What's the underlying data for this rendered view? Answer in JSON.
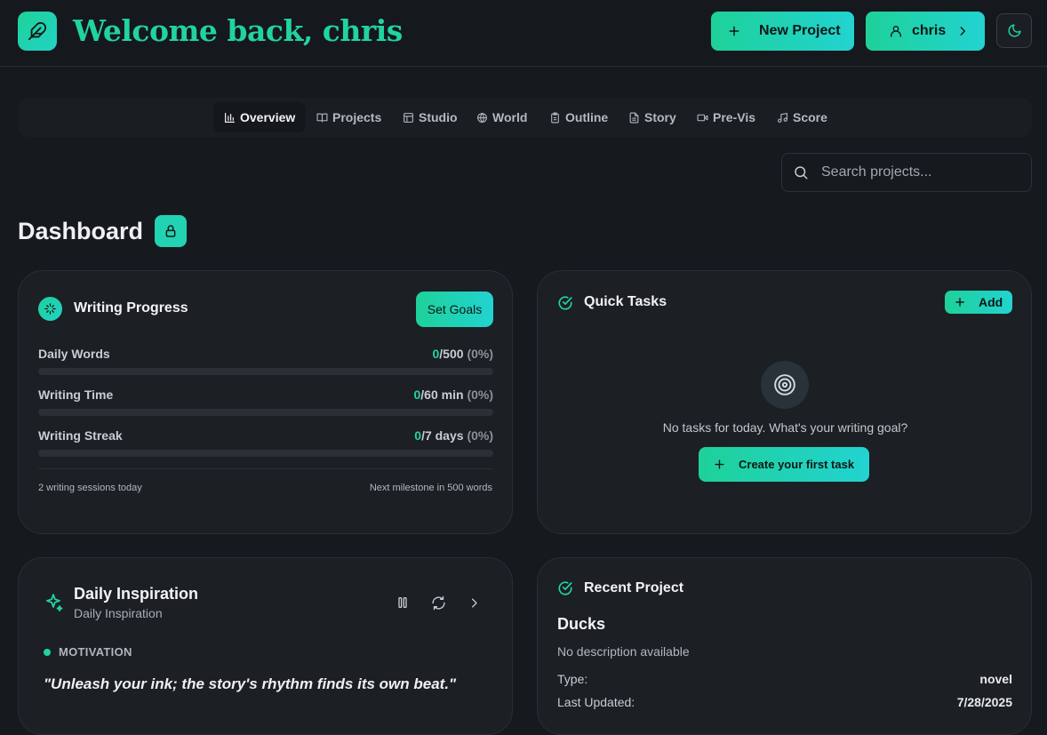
{
  "header": {
    "welcome": "Welcome back, chris",
    "new_project_label": "New Project",
    "user_label": "chris"
  },
  "nav": {
    "items": [
      {
        "label": "Overview",
        "icon": "bar-chart-icon"
      },
      {
        "label": "Projects",
        "icon": "book-open-icon"
      },
      {
        "label": "Studio",
        "icon": "layout-icon"
      },
      {
        "label": "World",
        "icon": "globe-icon"
      },
      {
        "label": "Outline",
        "icon": "clipboard-icon"
      },
      {
        "label": "Story",
        "icon": "file-text-icon"
      },
      {
        "label": "Pre-Vis",
        "icon": "video-icon"
      },
      {
        "label": "Score",
        "icon": "music-icon"
      }
    ],
    "active": "Overview"
  },
  "search": {
    "placeholder": "Search projects..."
  },
  "dashboard": {
    "title": "Dashboard"
  },
  "writing_progress": {
    "title": "Writing Progress",
    "set_goals_label": "Set Goals",
    "metrics": [
      {
        "label": "Daily Words",
        "current": "0",
        "target": "/500",
        "pct": "(0%)",
        "fraction": 0
      },
      {
        "label": "Writing Time",
        "current": "0",
        "target": "/60 min",
        "pct": "(0%)",
        "fraction": 0
      },
      {
        "label": "Writing Streak",
        "current": "0",
        "target": "/7 days",
        "pct": "(0%)",
        "fraction": 0
      }
    ],
    "sessions_text": "2 writing sessions today",
    "milestone_text": "Next milestone in 500 words"
  },
  "quick_tasks": {
    "title": "Quick Tasks",
    "add_label": "Add",
    "empty_text": "No tasks for today. What's your writing goal?",
    "create_label": "Create your first task"
  },
  "daily_inspiration": {
    "title": "Daily Inspiration",
    "subtitle": "Daily Inspiration",
    "category": "MOTIVATION",
    "quote": "\"Unleash your ink; the story's rhythm finds its own beat.\""
  },
  "recent_project": {
    "title": "Recent Project",
    "name": "Ducks",
    "description": "No description available",
    "type_label": "Type:",
    "type_value": "novel",
    "updated_label": "Last Updated:",
    "updated_value": "7/28/2025"
  },
  "colors": {
    "accent": "#22d3a0",
    "accent_cyan": "#22d3d1",
    "background": "#16191e",
    "card": "#1c1f24"
  }
}
